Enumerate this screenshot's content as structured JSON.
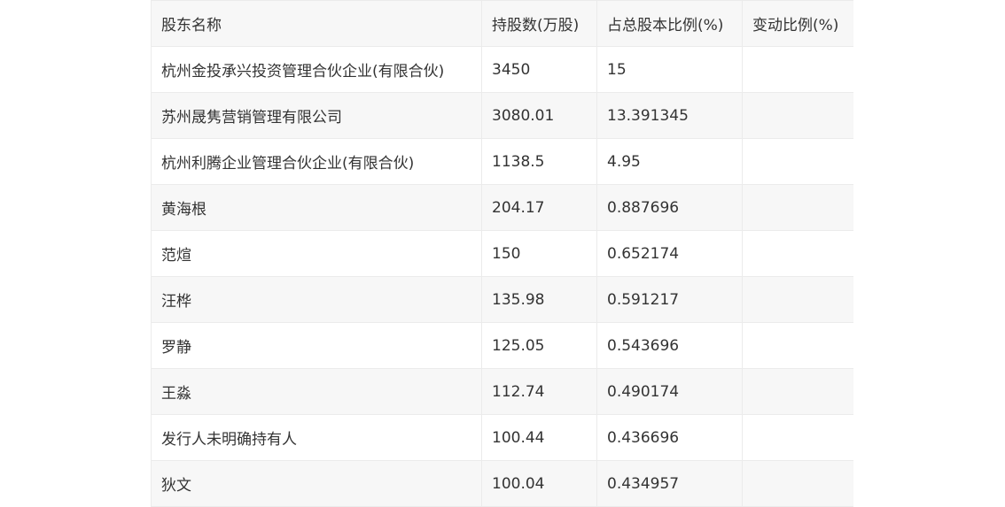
{
  "table": {
    "headers": [
      "股东名称",
      "持股数(万股)",
      "占总股本比例(%)",
      "变动比例(%)"
    ],
    "rows": [
      [
        "杭州金投承兴投资管理合伙企业(有限合伙)",
        "3450",
        "15",
        ""
      ],
      [
        "苏州晟隽营销管理有限公司",
        "3080.01",
        "13.391345",
        ""
      ],
      [
        "杭州利腾企业管理合伙企业(有限合伙)",
        "1138.5",
        "4.95",
        ""
      ],
      [
        "黄海根",
        "204.17",
        "0.887696",
        ""
      ],
      [
        "范煊",
        "150",
        "0.652174",
        ""
      ],
      [
        "汪桦",
        "135.98",
        "0.591217",
        ""
      ],
      [
        "罗静",
        "125.05",
        "0.543696",
        ""
      ],
      [
        "王淼",
        "112.74",
        "0.490174",
        ""
      ],
      [
        "发行人未明确持有人",
        "100.44",
        "0.436696",
        ""
      ],
      [
        "狄文",
        "100.04",
        "0.434957",
        ""
      ]
    ]
  }
}
